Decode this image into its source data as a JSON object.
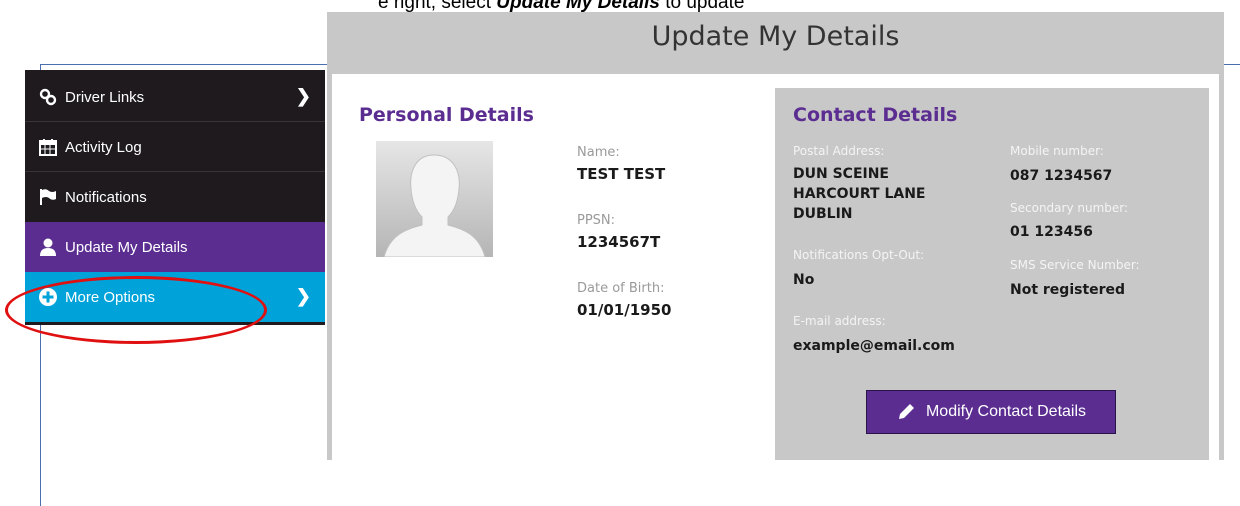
{
  "document": {
    "top_text_prefix": "e right, select",
    "top_text_bold": "Update My Details",
    "top_text_suffix": "to update"
  },
  "header": {
    "title": "Update My Details"
  },
  "sidebar": {
    "items": [
      {
        "label": "Driver Links",
        "icon": "link-icon"
      },
      {
        "label": "Activity Log",
        "icon": "calendar-icon"
      },
      {
        "label": "Notifications",
        "icon": "flag-icon"
      },
      {
        "label": "Update My Details",
        "icon": "user-icon"
      },
      {
        "label": "More Options",
        "icon": "plus-circle-icon"
      }
    ]
  },
  "personal": {
    "title": "Personal Details",
    "name_label": "Name:",
    "name": "TEST TEST",
    "ppsn_label": "PPSN:",
    "ppsn": "1234567T",
    "dob_label": "Date of Birth:",
    "dob": "01/01/1950"
  },
  "contact": {
    "title": "Contact Details",
    "postal_label": "Postal Address:",
    "postal_line1": "DUN SCEINE",
    "postal_line2": "HARCOURT LANE",
    "postal_line3": "DUBLIN",
    "optout_label": "Notifications Opt-Out:",
    "optout": "No",
    "email_label": "E-mail address:",
    "email": "example@email.com",
    "mobile_label": "Mobile number:",
    "mobile": "087 1234567",
    "secondary_label": "Secondary number:",
    "secondary": "01 123456",
    "sms_label": "SMS Service Number:",
    "sms": "Not registered",
    "modify_button": "Modify Contact Details"
  },
  "colors": {
    "brand_purple": "#5b2d91",
    "more_options_blue": "#00a3d9",
    "sidebar_dark": "#1e1a1d",
    "annotation_red": "#e01010"
  }
}
